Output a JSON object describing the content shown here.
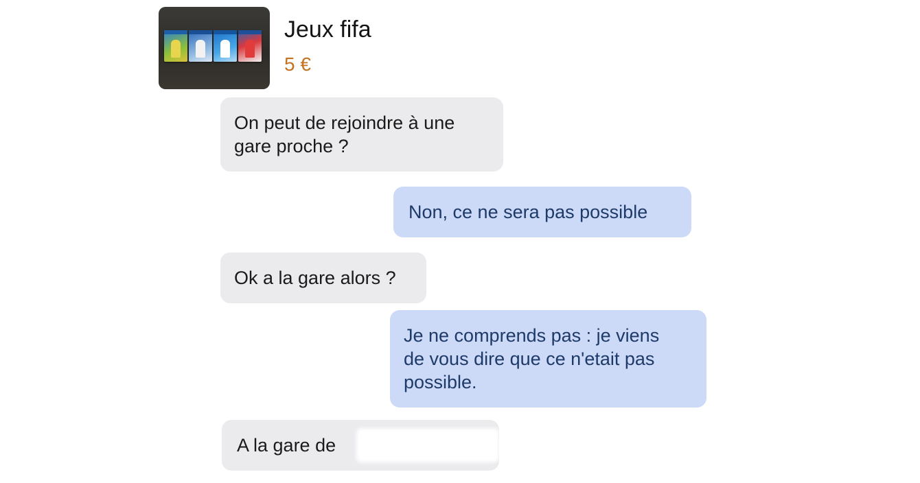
{
  "listing": {
    "title": "Jeux fifa",
    "price": "5 €",
    "thumbnail_icon": "game-cases-photo"
  },
  "colors": {
    "incoming_bubble": "#ebebee",
    "outgoing_bubble": "#ccd9f7",
    "price": "#c3721f"
  },
  "messages": [
    {
      "direction": "incoming",
      "lines": [
        "On peut de rejoindre à une",
        "gare proche ?"
      ]
    },
    {
      "direction": "outgoing",
      "lines": [
        "Non, ce ne sera pas possible"
      ]
    },
    {
      "direction": "incoming",
      "lines": [
        "Ok a la gare alors ?"
      ]
    },
    {
      "direction": "outgoing",
      "lines": [
        "Je ne comprends pas : je viens",
        "de vous dire que ce n'etait pas",
        "possible."
      ]
    },
    {
      "direction": "incoming",
      "lines": [
        "A la gare de"
      ]
    }
  ]
}
